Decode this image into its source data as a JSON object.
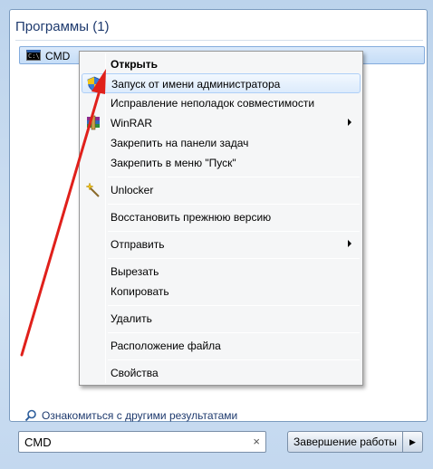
{
  "section": {
    "title": "Программы (1)"
  },
  "result": {
    "label": "CMD"
  },
  "more_results": {
    "label": "Ознакомиться с другими результатами"
  },
  "search": {
    "value": "CMD",
    "clear": "×"
  },
  "shutdown": {
    "label": "Завершение работы",
    "arrow": "▶"
  },
  "context_menu": {
    "items": [
      {
        "label": "Открыть",
        "bold": true
      },
      {
        "label": "Запуск от имени администратора",
        "icon": "uac-shield-icon",
        "hover": true
      },
      {
        "label": "Исправление неполадок совместимости"
      },
      {
        "label": "WinRAR",
        "icon": "winrar-icon",
        "submenu": true
      },
      {
        "label": "Закрепить на панели задач"
      },
      {
        "label": "Закрепить в меню \"Пуск\""
      },
      {
        "label": "Unlocker",
        "icon": "unlocker-wand-icon"
      },
      {
        "label": "Восстановить прежнюю версию"
      },
      {
        "label": "Отправить",
        "submenu": true
      },
      {
        "label": "Вырезать"
      },
      {
        "label": "Копировать"
      },
      {
        "label": "Удалить"
      },
      {
        "label": "Расположение файла"
      },
      {
        "label": "Свойства"
      }
    ]
  },
  "colors": {
    "annotation_arrow": "#e0201b",
    "menu_hover": "#dcebfc",
    "section_title": "#1e3a6e"
  }
}
